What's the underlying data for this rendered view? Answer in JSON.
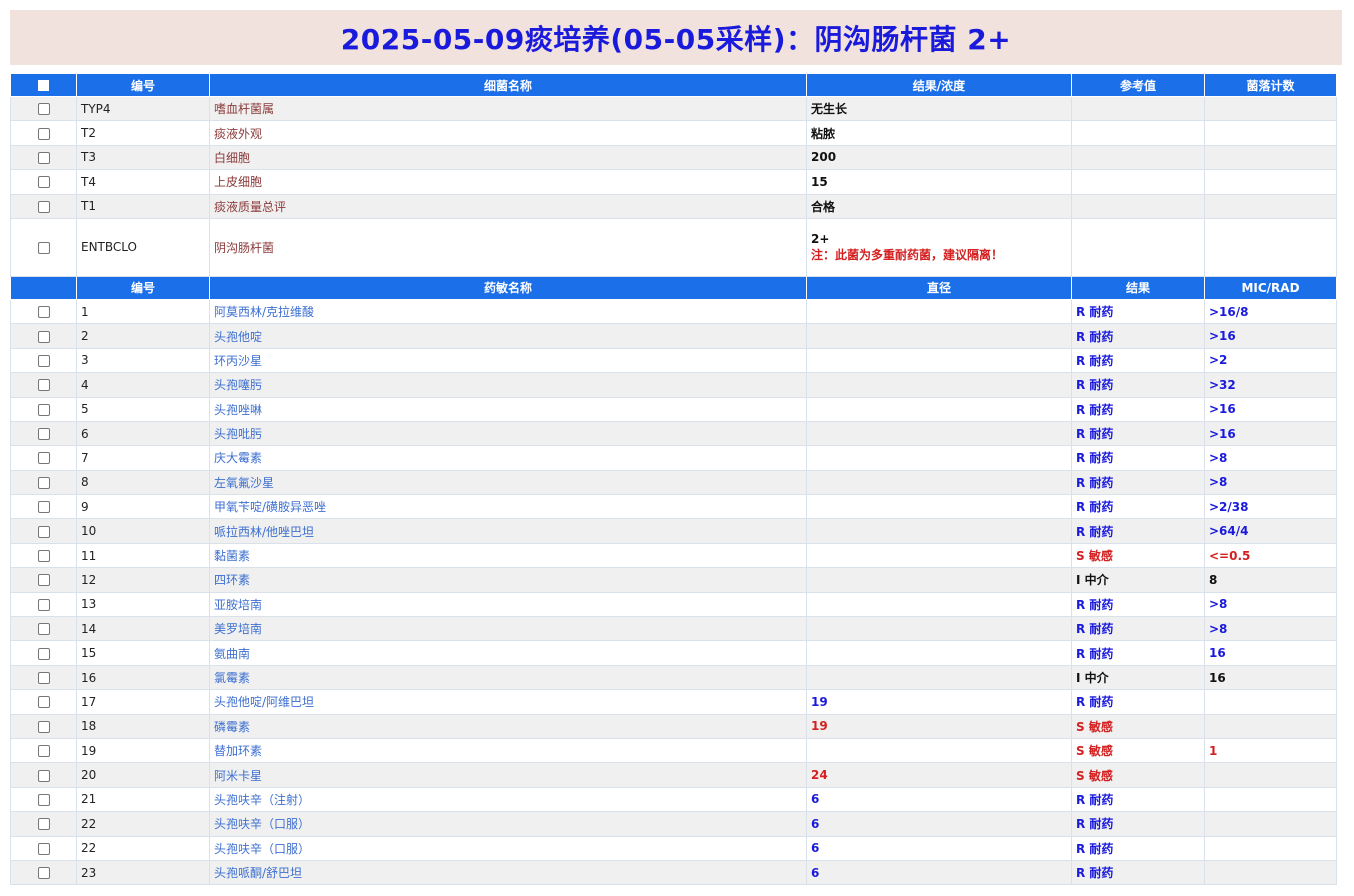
{
  "title": "2025-05-09痰培养(05-05采样)：阴沟肠杆菌 2+",
  "colors": {
    "header_bg": "#1b6fe8",
    "title_bg": "#f2e2dd",
    "title_text": "#1a1adc",
    "resistant": "#1a1adc",
    "sensitive": "#d42020",
    "intermediate": "#111111"
  },
  "bacteria_header": {
    "code": "编号",
    "name": "细菌名称",
    "result": "结果/浓度",
    "ref": "参考值",
    "count": "菌落计数"
  },
  "bacteria_rows": [
    {
      "code": "TYP4",
      "name": "嗜血杆菌属",
      "result": "无生长",
      "ref": "",
      "count": ""
    },
    {
      "code": "T2",
      "name": "痰液外观",
      "result": "粘脓",
      "ref": "",
      "count": ""
    },
    {
      "code": "T3",
      "name": "白细胞",
      "result": "200",
      "ref": "",
      "count": ""
    },
    {
      "code": "T4",
      "name": "上皮细胞",
      "result": "15",
      "ref": "",
      "count": ""
    },
    {
      "code": "T1",
      "name": "痰液质量总评",
      "result": "合格",
      "ref": "",
      "count": ""
    },
    {
      "code": "ENTBCLO",
      "name": "阴沟肠杆菌",
      "result": "2+",
      "note": "注：此菌为多重耐药菌，建议隔离！",
      "ref": "",
      "count": ""
    }
  ],
  "drug_header": {
    "code": "编号",
    "name": "药敏名称",
    "diameter": "直径",
    "result": "结果",
    "mic": "MIC/RAD"
  },
  "drug_rows": [
    {
      "code": "1",
      "name": "阿莫西林/克拉维酸",
      "diameter": "",
      "dia_color": "",
      "result": "R 耐药",
      "res": "R",
      "mic": ">16/8",
      "mic_color": "blue"
    },
    {
      "code": "2",
      "name": "头孢他啶",
      "diameter": "",
      "dia_color": "",
      "result": "R 耐药",
      "res": "R",
      "mic": ">16",
      "mic_color": "blue"
    },
    {
      "code": "3",
      "name": "环丙沙星",
      "diameter": "",
      "dia_color": "",
      "result": "R 耐药",
      "res": "R",
      "mic": ">2",
      "mic_color": "blue"
    },
    {
      "code": "4",
      "name": "头孢噻肟",
      "diameter": "",
      "dia_color": "",
      "result": "R 耐药",
      "res": "R",
      "mic": ">32",
      "mic_color": "blue"
    },
    {
      "code": "5",
      "name": "头孢唑啉",
      "diameter": "",
      "dia_color": "",
      "result": "R 耐药",
      "res": "R",
      "mic": ">16",
      "mic_color": "blue"
    },
    {
      "code": "6",
      "name": "头孢吡肟",
      "diameter": "",
      "dia_color": "",
      "result": "R 耐药",
      "res": "R",
      "mic": ">16",
      "mic_color": "blue"
    },
    {
      "code": "7",
      "name": "庆大霉素",
      "diameter": "",
      "dia_color": "",
      "result": "R 耐药",
      "res": "R",
      "mic": ">8",
      "mic_color": "blue"
    },
    {
      "code": "8",
      "name": "左氧氟沙星",
      "diameter": "",
      "dia_color": "",
      "result": "R 耐药",
      "res": "R",
      "mic": ">8",
      "mic_color": "blue"
    },
    {
      "code": "9",
      "name": "甲氧苄啶/磺胺异恶唑",
      "diameter": "",
      "dia_color": "",
      "result": "R 耐药",
      "res": "R",
      "mic": ">2/38",
      "mic_color": "blue"
    },
    {
      "code": "10",
      "name": "哌拉西林/他唑巴坦",
      "diameter": "",
      "dia_color": "",
      "result": "R 耐药",
      "res": "R",
      "mic": ">64/4",
      "mic_color": "blue"
    },
    {
      "code": "11",
      "name": "黏菌素",
      "diameter": "",
      "dia_color": "",
      "result": "S 敏感",
      "res": "S",
      "mic": "<=0.5",
      "mic_color": "red"
    },
    {
      "code": "12",
      "name": "四环素",
      "diameter": "",
      "dia_color": "",
      "result": "I 中介",
      "res": "I",
      "mic": "8",
      "mic_color": "black"
    },
    {
      "code": "13",
      "name": "亚胺培南",
      "diameter": "",
      "dia_color": "",
      "result": "R 耐药",
      "res": "R",
      "mic": ">8",
      "mic_color": "blue"
    },
    {
      "code": "14",
      "name": "美罗培南",
      "diameter": "",
      "dia_color": "",
      "result": "R 耐药",
      "res": "R",
      "mic": ">8",
      "mic_color": "blue"
    },
    {
      "code": "15",
      "name": "氨曲南",
      "diameter": "",
      "dia_color": "",
      "result": "R 耐药",
      "res": "R",
      "mic": "16",
      "mic_color": "blue"
    },
    {
      "code": "16",
      "name": "氯霉素",
      "diameter": "",
      "dia_color": "",
      "result": "I 中介",
      "res": "I",
      "mic": "16",
      "mic_color": "black"
    },
    {
      "code": "17",
      "name": "头孢他啶/阿维巴坦",
      "diameter": "19",
      "dia_color": "blue",
      "result": "R 耐药",
      "res": "R",
      "mic": "",
      "mic_color": ""
    },
    {
      "code": "18",
      "name": "磷霉素",
      "diameter": "19",
      "dia_color": "red",
      "result": "S 敏感",
      "res": "S",
      "mic": "",
      "mic_color": ""
    },
    {
      "code": "19",
      "name": "替加环素",
      "diameter": "",
      "dia_color": "",
      "result": "S 敏感",
      "res": "S",
      "mic": "1",
      "mic_color": "red"
    },
    {
      "code": "20",
      "name": "阿米卡星",
      "diameter": "24",
      "dia_color": "red",
      "result": "S 敏感",
      "res": "S",
      "mic": "",
      "mic_color": ""
    },
    {
      "code": "21",
      "name": "头孢呋辛（注射）",
      "diameter": "6",
      "dia_color": "blue",
      "result": "R 耐药",
      "res": "R",
      "mic": "",
      "mic_color": ""
    },
    {
      "code": "22",
      "name": "头孢呋辛（口服）",
      "diameter": "6",
      "dia_color": "blue",
      "result": "R 耐药",
      "res": "R",
      "mic": "",
      "mic_color": ""
    },
    {
      "code": "22",
      "name": "头孢呋辛（口服）",
      "diameter": "6",
      "dia_color": "blue",
      "result": "R 耐药",
      "res": "R",
      "mic": "",
      "mic_color": ""
    },
    {
      "code": "23",
      "name": "头孢哌酮/舒巴坦",
      "diameter": "6",
      "dia_color": "blue",
      "result": "R 耐药",
      "res": "R",
      "mic": "",
      "mic_color": ""
    }
  ]
}
